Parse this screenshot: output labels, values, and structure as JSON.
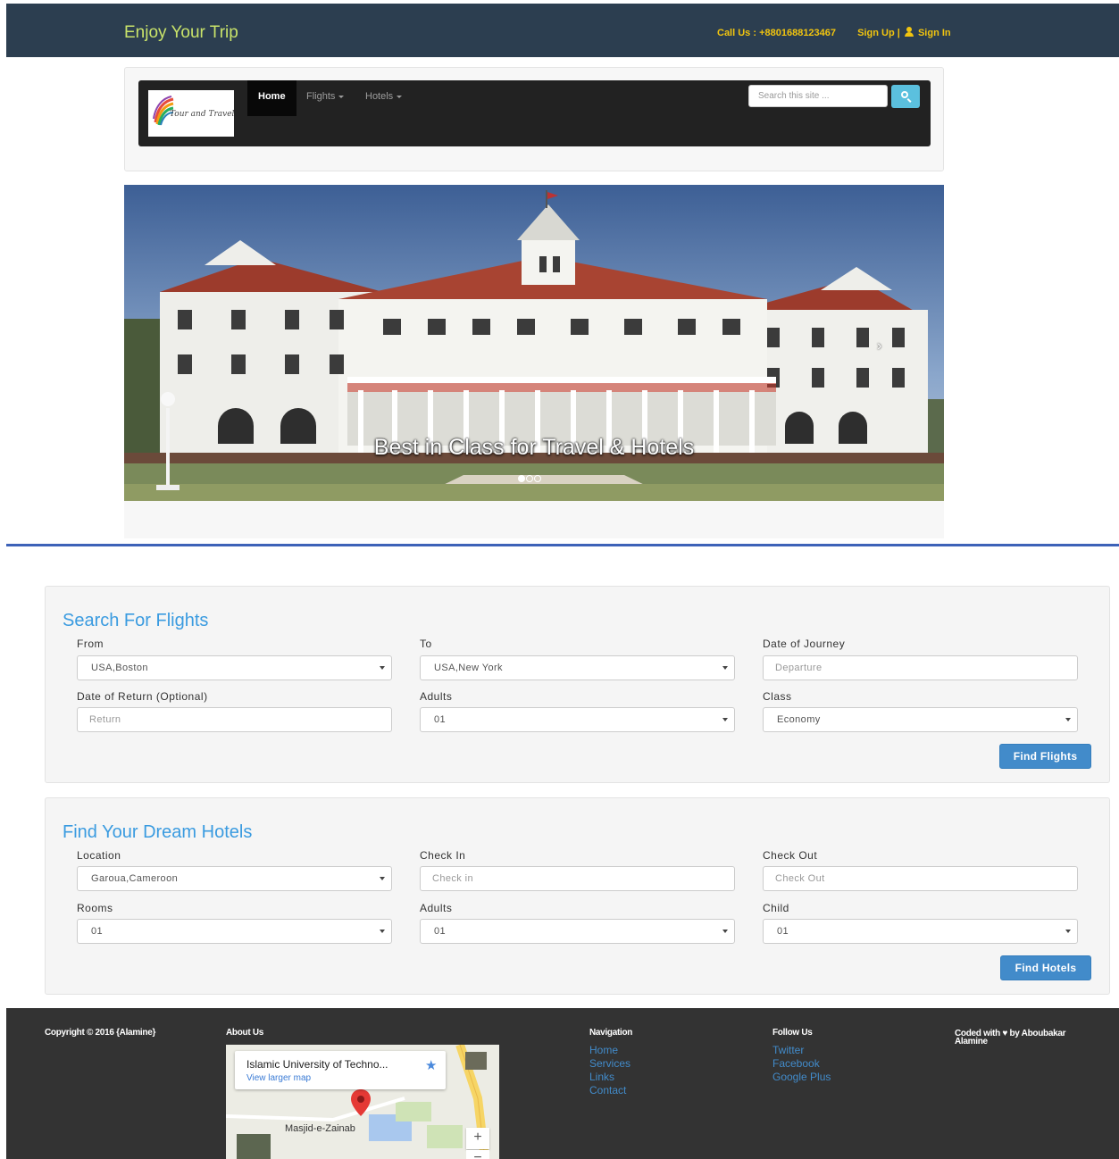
{
  "header": {
    "brand": "Enjoy Your Trip",
    "call_us": "Call Us : +8801688123467",
    "sign_up": "Sign Up |",
    "sign_in": "Sign In"
  },
  "navbar": {
    "logo_text": "Tour and Travel",
    "items": [
      {
        "label": "Home",
        "active": true
      },
      {
        "label": "Flights",
        "dropdown": true
      },
      {
        "label": "Hotels",
        "dropdown": true
      }
    ],
    "search_placeholder": "Search this site ..."
  },
  "carousel": {
    "caption": "Best in Class for Travel & Hotels",
    "slide_count": 3,
    "active_slide": 1
  },
  "flights": {
    "title": "Search For Flights",
    "from_label": "From",
    "from_value": "USA,Boston",
    "to_label": "To",
    "to_value": "USA,New York",
    "journey_label": "Date of Journey",
    "journey_placeholder": "Departure",
    "return_label": "Date of Return (Optional)",
    "return_placeholder": "Return",
    "adults_label": "Adults",
    "adults_value": "01",
    "class_label": "Class",
    "class_value": "Economy",
    "button": "Find Flights"
  },
  "hotels": {
    "title": "Find Your Dream Hotels",
    "location_label": "Location",
    "location_value": "Garoua,Cameroon",
    "checkin_label": "Check In",
    "checkin_placeholder": "Check in",
    "checkout_label": "Check Out",
    "checkout_placeholder": "Check Out",
    "rooms_label": "Rooms",
    "rooms_value": "01",
    "adults_label": "Adults",
    "adults_value": "01",
    "child_label": "Child",
    "child_value": "01",
    "button": "Find Hotels"
  },
  "footer": {
    "copyright": "Copyright © 2016 {Alamine}",
    "about_title": "About Us",
    "map_title": "Islamic University of Techno...",
    "map_link": "View larger map",
    "map_place": "Masjid-e-Zainab",
    "nav_title": "Navigation",
    "nav_links": [
      "Home",
      "Services",
      "Links",
      "Contact"
    ],
    "follow_title": "Follow Us",
    "follow_links": [
      "Twitter",
      "Facebook",
      "Google Plus"
    ],
    "coded_prefix": "Coded with",
    "coded_suffix": "by Aboubakar Alamine"
  },
  "colors": {
    "topbar": "#2c3e50",
    "brand": "#c9e36a",
    "topbar_links": "#f1c40f",
    "panel_title": "#3a9be0",
    "primary_button": "#428bca",
    "footer_bg": "#333333"
  }
}
